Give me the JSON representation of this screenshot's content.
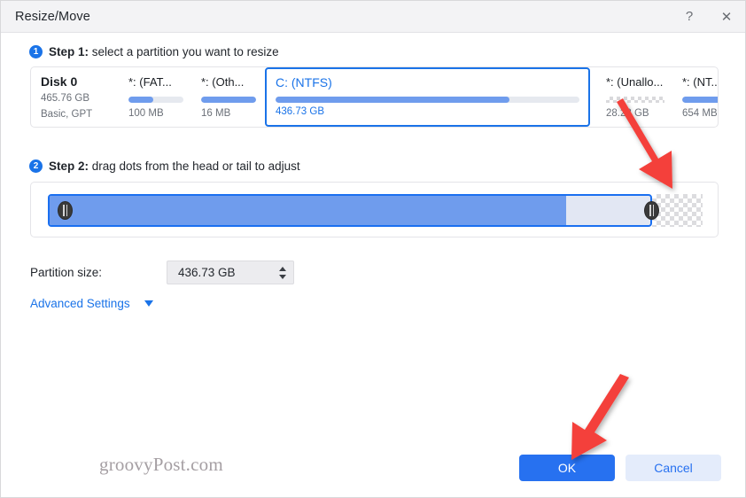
{
  "window": {
    "title": "Resize/Move",
    "help_icon": "question-mark-icon",
    "close_icon": "close-icon",
    "help_glyph": "?",
    "close_glyph": "✕"
  },
  "steps": {
    "one": {
      "number": "1",
      "prefix": "Step 1:",
      "text": " select a partition you want to resize"
    },
    "two": {
      "number": "2",
      "prefix": "Step 2:",
      "text": " drag dots from the head or tail to adjust"
    }
  },
  "disk": {
    "name": "Disk 0",
    "capacity": "465.76 GB",
    "type": "Basic, GPT"
  },
  "partitions": [
    {
      "name": "*: (FAT...",
      "size": "100 MB",
      "used_pct": 45,
      "selected": false,
      "unallocated": false
    },
    {
      "name": "*: (Oth...",
      "size": "16 MB",
      "used_pct": 100,
      "selected": false,
      "unallocated": false
    },
    {
      "name": "C: (NTFS)",
      "size": "436.73 GB",
      "used_pct": 77,
      "selected": true,
      "unallocated": false
    },
    {
      "name": "*: (Unallo...",
      "size": "28.28 GB",
      "used_pct": 0,
      "selected": false,
      "unallocated": true
    },
    {
      "name": "*: (NT...",
      "size": "654 MB",
      "used_pct": 86,
      "selected": false,
      "unallocated": false
    }
  ],
  "slider": {
    "left_handle": "left-drag-handle",
    "right_handle": "right-drag-handle",
    "partition_pct": 92,
    "used_pct": 79,
    "unallocated_pct": 8
  },
  "partition_size": {
    "label": "Partition size:",
    "value": "436.73 GB",
    "increment_icon": "caret-up-icon",
    "decrement_icon": "caret-down-icon"
  },
  "advanced": {
    "label": "Advanced Settings",
    "caret_icon": "caret-down-icon"
  },
  "footer": {
    "ok": "OK",
    "cancel": "Cancel"
  },
  "watermark": "groovyPost.com",
  "annotations": {
    "arrow_color": "#f4403a",
    "arrow_top": "arrow-pointing-to-unallocated-slider",
    "arrow_bottom": "arrow-pointing-to-ok-button"
  },
  "colors": {
    "accent": "#1a73e8",
    "primary_button": "#2771f0",
    "bar_fill": "#6f9ced",
    "bar_track": "#e6e9ef"
  }
}
